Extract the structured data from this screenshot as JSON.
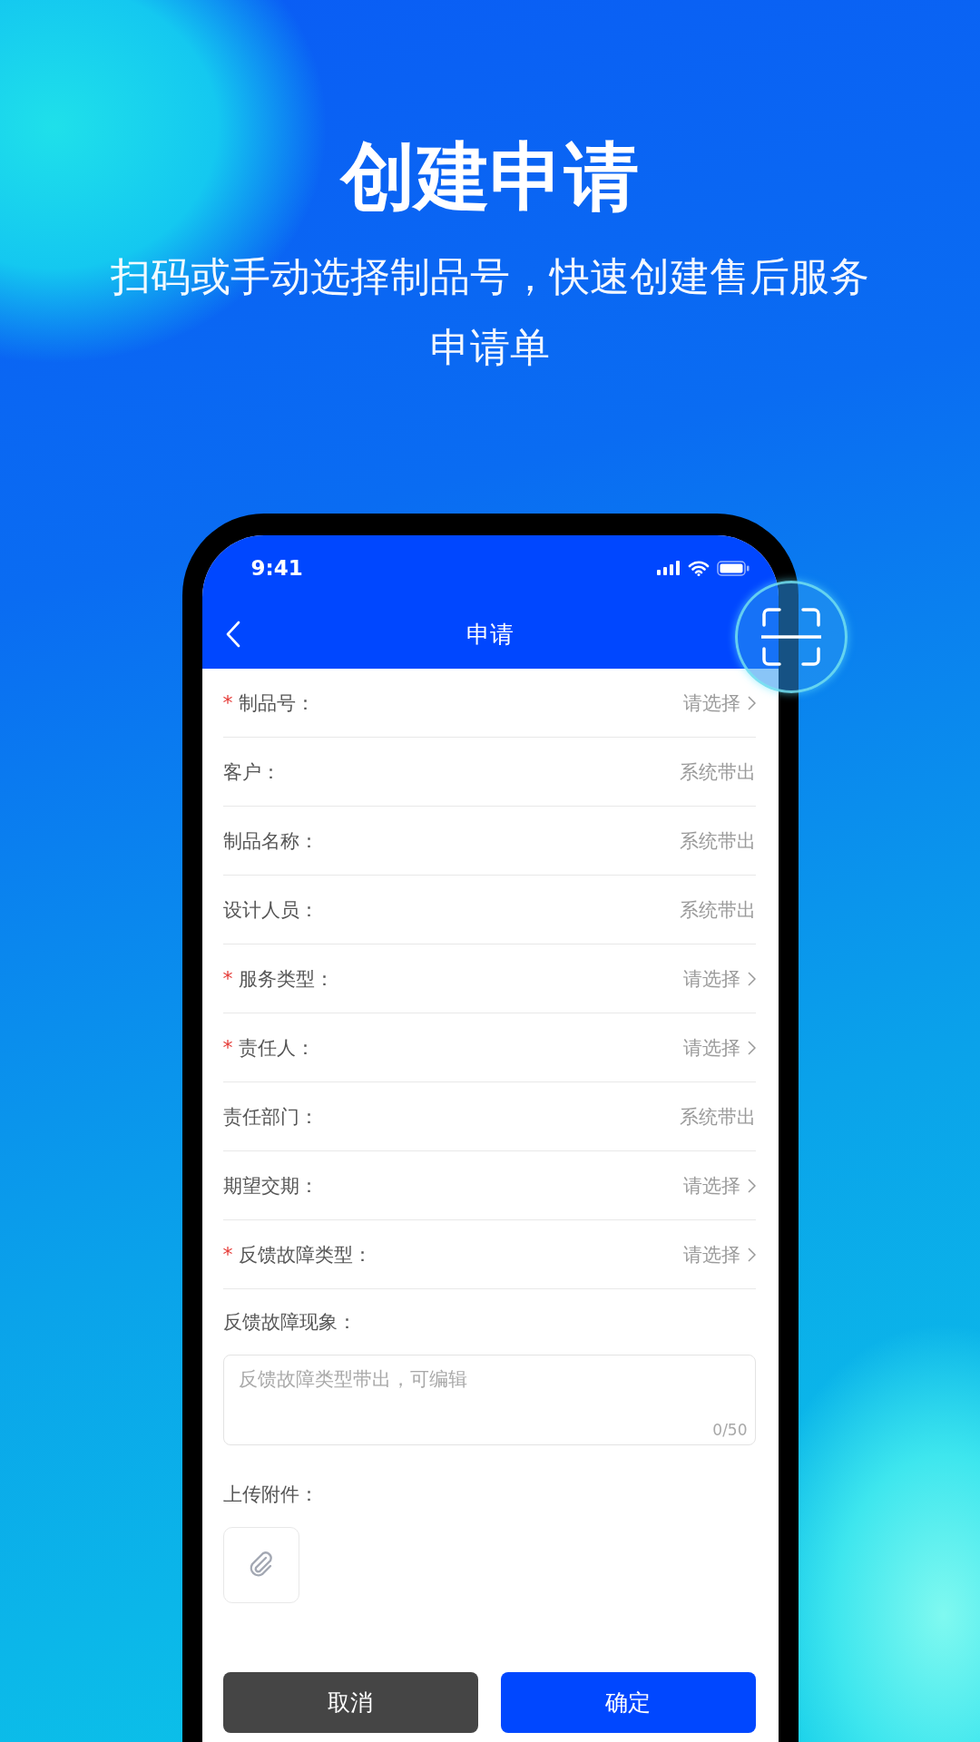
{
  "headline": "创建申请",
  "subtitle": "扫码或手动选择制品号，快速创建售后服务申请单",
  "status_bar": {
    "time": "9:41"
  },
  "nav": {
    "title": "申请"
  },
  "fields": [
    {
      "label": "制品号：",
      "value": "请选择",
      "kind": "select",
      "required": true
    },
    {
      "label": "客户：",
      "value": "系统带出",
      "kind": "auto",
      "required": false
    },
    {
      "label": "制品名称：",
      "value": "系统带出",
      "kind": "auto",
      "required": false
    },
    {
      "label": "设计人员：",
      "value": "系统带出",
      "kind": "auto",
      "required": false
    },
    {
      "label": "服务类型：",
      "value": "请选择",
      "kind": "select",
      "required": true
    },
    {
      "label": "责任人：",
      "value": "请选择",
      "kind": "select",
      "required": true
    },
    {
      "label": "责任部门：",
      "value": "系统带出",
      "kind": "auto",
      "required": false
    },
    {
      "label": "期望交期：",
      "value": "请选择",
      "kind": "select",
      "required": false
    },
    {
      "label": "反馈故障类型：",
      "value": "请选择",
      "kind": "select",
      "required": true
    }
  ],
  "required_mark": "*",
  "description": {
    "label": "反馈故障现象：",
    "placeholder": "反馈故障类型带出，可编辑",
    "counter": "0/50"
  },
  "attachment": {
    "label": "上传附件："
  },
  "buttons": [
    {
      "label": "取消",
      "kind": "secondary"
    },
    {
      "label": "确定",
      "kind": "primary"
    }
  ]
}
